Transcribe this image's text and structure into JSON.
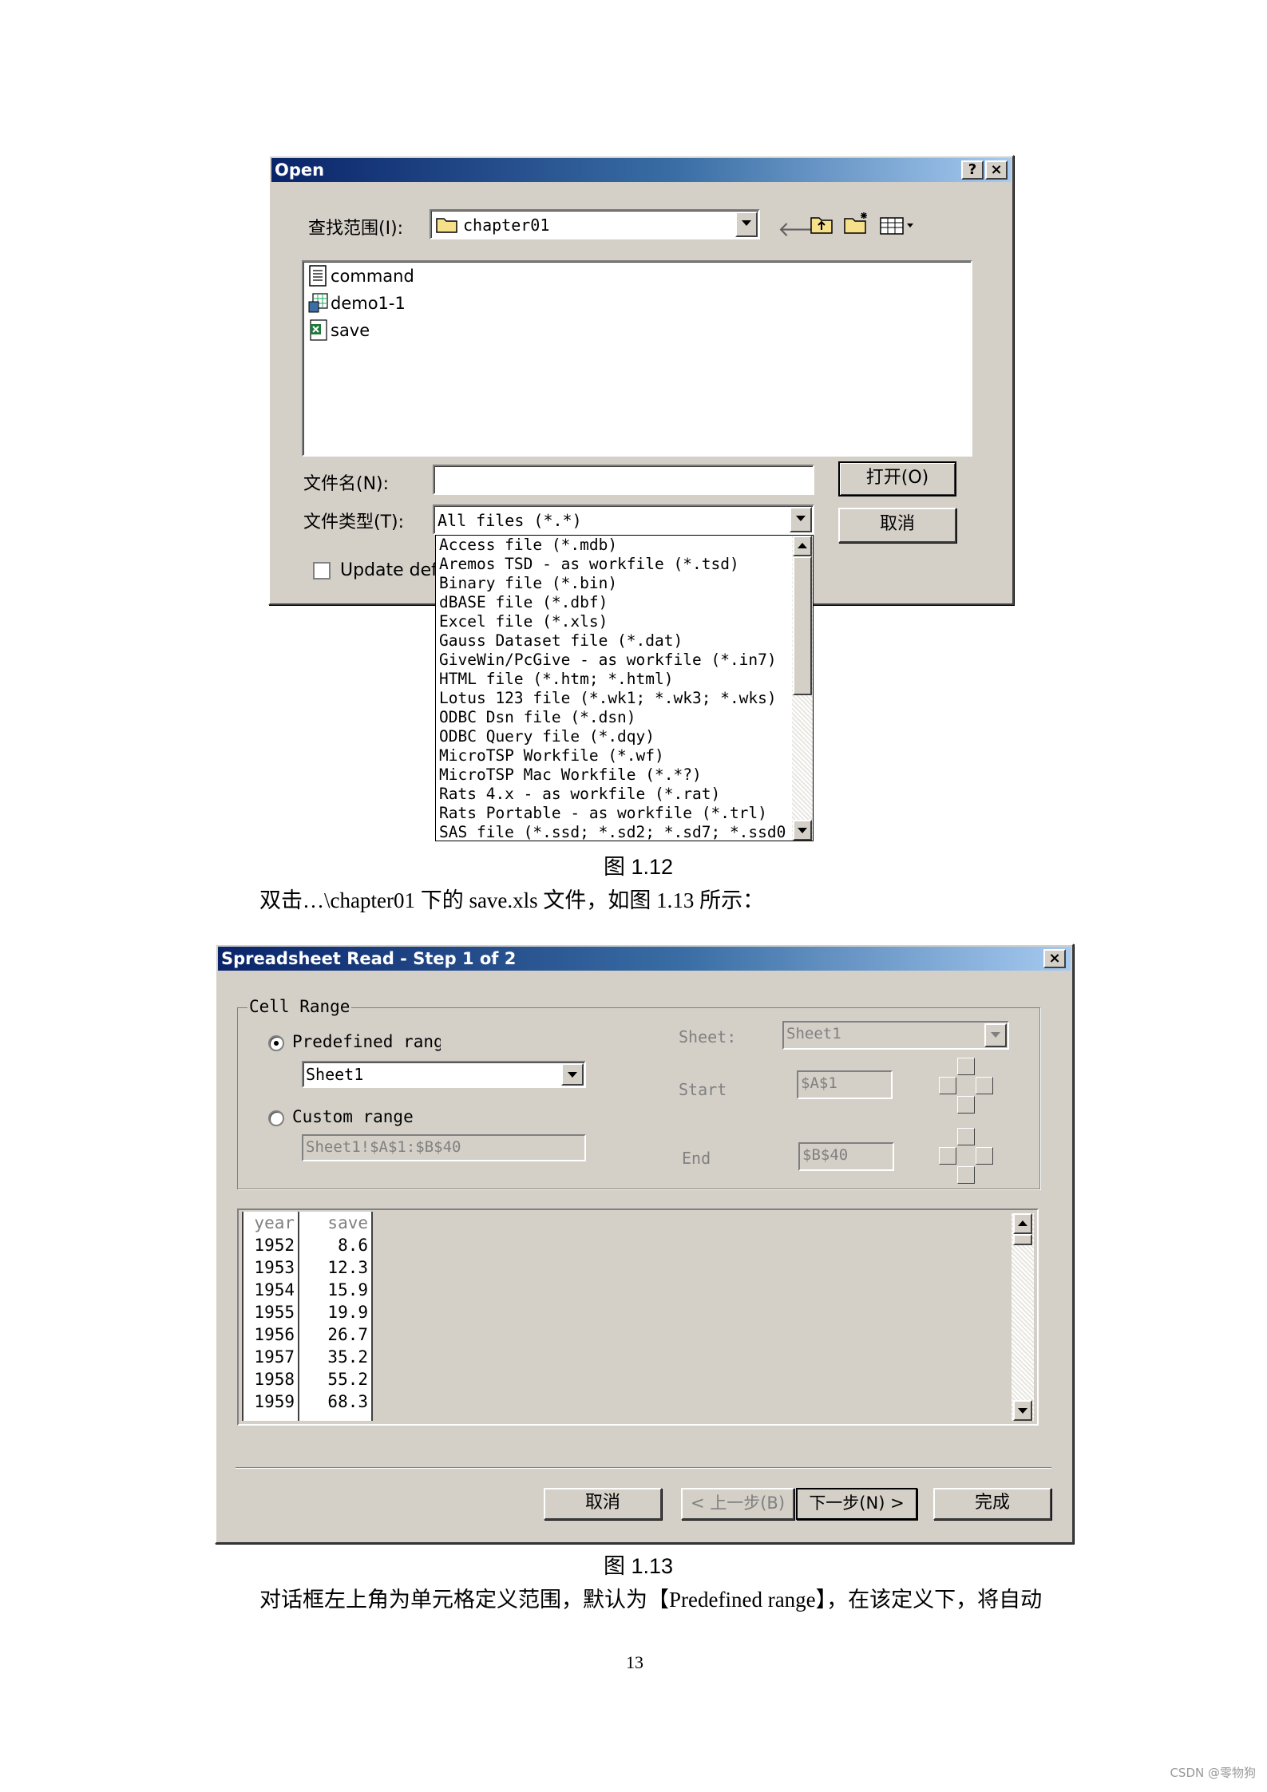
{
  "open_dialog": {
    "title": "Open",
    "help_btn": "?",
    "close_btn": "×",
    "look_in_label": "查找范围(I):",
    "look_in_value": "chapter01",
    "files": [
      "command",
      "demo1-1",
      "save"
    ],
    "filename_label": "文件名(N):",
    "filename_value": "",
    "filetype_label": "文件类型(T):",
    "filetype_value": "All files (*.*)",
    "open_button": "打开(O)",
    "cancel_button": "取消",
    "update_checkbox": "Update defa",
    "filetype_options": [
      "Access file (*.mdb)",
      "Aremos TSD - as workfile (*.tsd)",
      "Binary file (*.bin)",
      "dBASE file (*.dbf)",
      "Excel file (*.xls)",
      "Gauss Dataset file (*.dat)",
      "GiveWin/PcGive - as workfile (*.in7)",
      "HTML file (*.htm; *.html)",
      "Lotus 123 file (*.wk1; *.wk3; *.wks)",
      "ODBC Dsn file (*.dsn)",
      "ODBC Query file (*.dqy)",
      "MicroTSP Workfile (*.wf)",
      "MicroTSP Mac Workfile (*.*?)",
      "Rats 4.x - as workfile (*.rat)",
      "Rats Portable - as workfile (*.trl)",
      "SAS file (*.ssd; *.sd2; *.sd7; *.ssd0"
    ]
  },
  "caption1": "图 1.12",
  "text1": "双击…\\chapter01 下的 save.xls 文件，如图 1.13 所示：",
  "spreadsheet_dialog": {
    "title": "Spreadsheet Read - Step 1 of 2",
    "close_btn": "×",
    "group_label": "Cell Range",
    "predefined_label": "Predefined range",
    "predefined_value": "Sheet1",
    "custom_label": "Custom range",
    "custom_value": "Sheet1!$A$1:$B$40",
    "sheet_label": "Sheet:",
    "sheet_value": "Sheet1",
    "start_label": "Start",
    "start_value": "$A$1",
    "end_label": "End",
    "end_value": "$B$40",
    "table": {
      "headers": [
        "year",
        "save"
      ],
      "rows": [
        [
          "1952",
          "8.6"
        ],
        [
          "1953",
          "12.3"
        ],
        [
          "1954",
          "15.9"
        ],
        [
          "1955",
          "19.9"
        ],
        [
          "1956",
          "26.7"
        ],
        [
          "1957",
          "35.2"
        ],
        [
          "1958",
          "55.2"
        ],
        [
          "1959",
          "68.3"
        ]
      ]
    },
    "cancel_button": "取消",
    "back_button": "< 上一步(B)",
    "next_button": "下一步(N) >",
    "finish_button": "完成"
  },
  "caption2": "图 1.13",
  "text2": "对话框左上角为单元格定义范围，默认为【Predefined range】，在该定义下，将自动",
  "page_number": "13",
  "watermark": "CSDN @零物狗"
}
